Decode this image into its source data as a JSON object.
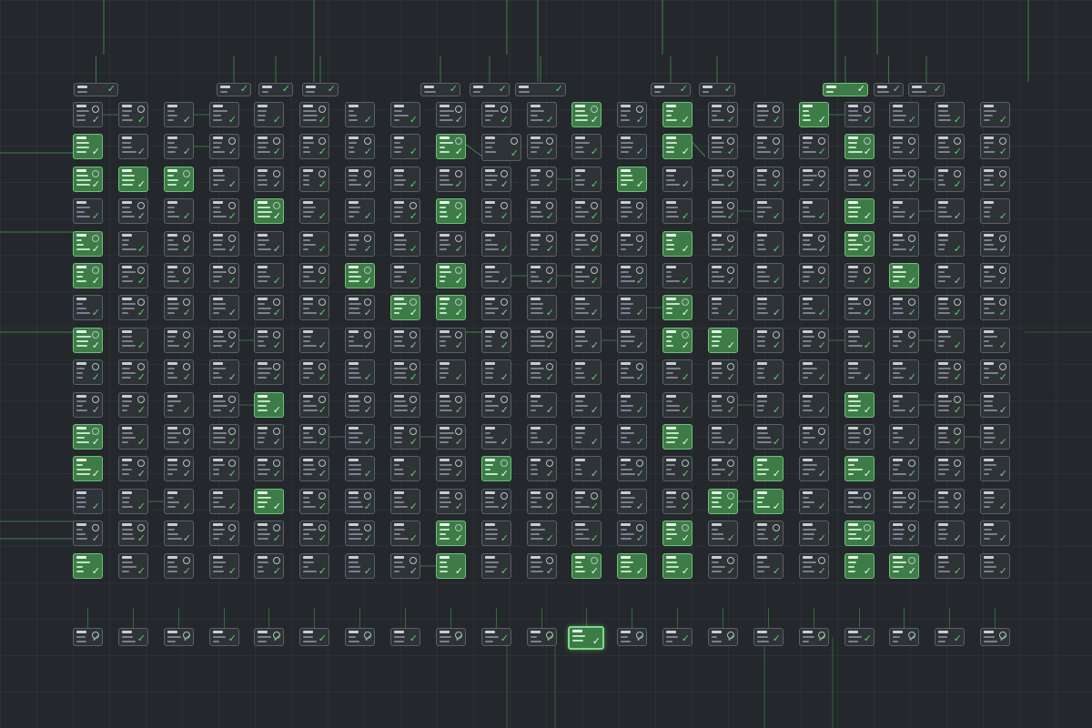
{
  "canvas": {
    "background": "#24282c",
    "grid_color": "#ffffff"
  },
  "colors": {
    "node_fill": "#2e3338",
    "node_border": "#5a6068",
    "active_fill": "#3d7c47",
    "active_border": "#6fc07a",
    "check": "#62c96d",
    "wire": "#5fbf6a"
  },
  "icons": {
    "status": "checkmark-icon",
    "secondary": "circle-status-icon"
  },
  "workflow": {
    "top_node_count": 11,
    "grid_rows": 15,
    "grid_cols": 21,
    "bottom_node_count": 21
  }
}
